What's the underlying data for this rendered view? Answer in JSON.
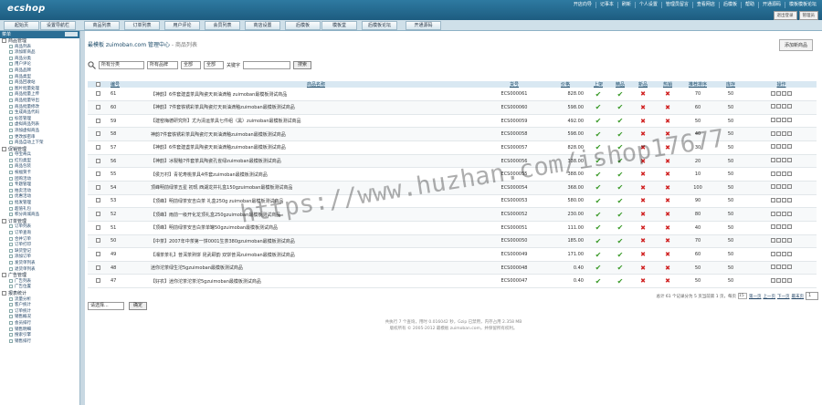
{
  "app": {
    "logo": "ecshop"
  },
  "top_links": [
    "开店向导",
    "记事本",
    "刷新",
    "个人设置",
    "管理员留言",
    "查看网店",
    "后模板",
    "帮助",
    "开通源码",
    "模板模板论坛"
  ],
  "top_buttons": [
    "退出登录",
    "管理员"
  ],
  "nav_tabs": [
    "起始页",
    "设置导航栏",
    "商品列表",
    "订单列表",
    "用户评论",
    "会员列表",
    "商店设置",
    "后模板",
    "模板堂",
    "后模板论坛",
    "开通源码"
  ],
  "sidebar": {
    "header": "菜单",
    "groups": [
      {
        "label": "商品管理",
        "items": [
          "商品列表",
          "添加新商品",
          "商品分类",
          "用户评论",
          "商品品牌",
          "商品类型",
          "商品回收站",
          "图片批量处理",
          "商品批量上传",
          "商品批量导出",
          "商品批量修改",
          "生成商品代码",
          "标签管理",
          "虚拟商品列表",
          "添加虚拟商品",
          "更改加密串",
          "商品自动上下架"
        ]
      },
      {
        "label": "促销管理",
        "items": [
          "夺宝奇兵",
          "红包类型",
          "商品包装",
          "祝福贺卡",
          "团购活动",
          "专题管理",
          "拍卖活动",
          "优惠活动",
          "批发管理",
          "超值礼包",
          "积分商城商品"
        ]
      },
      {
        "label": "订单管理",
        "items": [
          "订单列表",
          "订单查询",
          "合并订单",
          "订单打印",
          "缺货登记",
          "添加订单",
          "发货单列表",
          "退货单列表"
        ]
      },
      {
        "label": "广告管理",
        "items": [
          "广告列表",
          "广告位置"
        ]
      },
      {
        "label": "报表统计",
        "items": [
          "流量分析",
          "客户统计",
          "订单统计",
          "销售概况",
          "会员排行",
          "销售明细",
          "搜索引擎",
          "销售排行"
        ]
      }
    ]
  },
  "page": {
    "title": "最模板 zuimoban.com 管理中心",
    "subtitle": " - 商品列表",
    "add_button": "添加新商品"
  },
  "filter": {
    "category": "所有分类",
    "brand": "所有品牌",
    "all1": "全部",
    "all2": "全部",
    "keyword_label": "关键字",
    "search_button": "搜索"
  },
  "table": {
    "headers": [
      "编号",
      "商品名称",
      "货号",
      "价格",
      "上架",
      "精品",
      "新品",
      "热销",
      "推荐排序",
      "库存",
      "操作"
    ],
    "rows": [
      {
        "id": "61",
        "name": "【神韵】6件套建盏茶具陶瓷天目油滴釉 zuimoban最模板测试商品",
        "sn": "ECS000061",
        "price": "828.00",
        "on_sale": true,
        "best": true,
        "new": false,
        "hot": false,
        "sort": "70",
        "stock": "50"
      },
      {
        "id": "60",
        "name": "【神韵】7件套铁锈彩茶具陶瓷灯天目油滴釉zuimoban最模板测试商品",
        "sn": "ECS000060",
        "price": "598.00",
        "on_sale": true,
        "best": true,
        "new": false,
        "hot": false,
        "sort": "60",
        "stock": "50"
      },
      {
        "id": "59",
        "name": "【建窑梅德研究所】尤为清运茶具七件组（黑）zuimoban最模板测试商品",
        "sn": "ECS000059",
        "price": "492.00",
        "on_sale": true,
        "best": true,
        "new": false,
        "hot": false,
        "sort": "50",
        "stock": "50"
      },
      {
        "id": "58",
        "name": "神韵7件套铁锈彩茶具陶瓷灯天目油滴釉zuimoban最模板测试商品",
        "sn": "ECS000058",
        "price": "598.00",
        "on_sale": true,
        "best": true,
        "new": false,
        "hot": false,
        "sort": "40",
        "stock": "50"
      },
      {
        "id": "57",
        "name": "【神韵】6件套建盏茶具陶瓷天目油滴釉zuimoban最模板测试商品",
        "sn": "ECS000057",
        "price": "828.00",
        "on_sale": true,
        "best": true,
        "new": false,
        "hot": false,
        "sort": "30",
        "stock": "50"
      },
      {
        "id": "56",
        "name": "【神韵】冰裂釉7件套茶具陶瓷孔雀绿zuimoban最模板测试商品",
        "sn": "ECS000056",
        "price": "338.00",
        "on_sale": true,
        "best": true,
        "new": false,
        "hot": false,
        "sort": "20",
        "stock": "50"
      },
      {
        "id": "55",
        "name": "【侯万村】青花寿桃茶具4件套zuimoban最模板测试商品",
        "sn": "ECS000055",
        "price": "388.00",
        "on_sale": true,
        "best": true,
        "new": false,
        "hot": false,
        "sort": "10",
        "stock": "50"
      },
      {
        "id": "54",
        "name": "顶峰明前绿茶五星 初现 西湖龙井礼盒150gzuimoban最模板测试商品",
        "sn": "ECS000054",
        "price": "368.00",
        "on_sale": true,
        "best": true,
        "new": false,
        "hot": false,
        "sort": "100",
        "stock": "50"
      },
      {
        "id": "53",
        "name": "【顶峰】明前绿茶安吉白茶 礼盒250g zuimoban最模板测试商品",
        "sn": "ECS000053",
        "price": "580.00",
        "on_sale": true,
        "best": true,
        "new": false,
        "hot": false,
        "sort": "90",
        "stock": "50"
      },
      {
        "id": "52",
        "name": "【顶峰】雨前一级开化龙顶礼盒250gzuimoban最模板测试商品",
        "sn": "ECS000052",
        "price": "230.00",
        "on_sale": true,
        "best": true,
        "new": false,
        "hot": false,
        "sort": "80",
        "stock": "50"
      },
      {
        "id": "51",
        "name": "【顶峰】明前绿茶安吉白茶单罐50gzuimoban最模板测试商品",
        "sn": "ECS000051",
        "price": "111.00",
        "on_sale": true,
        "best": true,
        "new": false,
        "hot": false,
        "sort": "40",
        "stock": "50"
      },
      {
        "id": "50",
        "name": "【中茶】2007年中茶第一饼0001生茶380gzuimoban最模板测试商品",
        "sn": "ECS000050",
        "price": "185.00",
        "on_sale": true,
        "best": true,
        "new": false,
        "hot": false,
        "sort": "70",
        "stock": "50"
      },
      {
        "id": "49",
        "name": "【湘茶茶礼】普洱茶熟饼 昆武颐韵 双饼普洱zuimoban最模板测试商品",
        "sn": "ECS000049",
        "price": "171.00",
        "on_sale": true,
        "best": true,
        "new": false,
        "hot": false,
        "sort": "60",
        "stock": "50"
      },
      {
        "id": "48",
        "name": "迷你沱茶绿生沱5gzuimoban最模板测试商品",
        "sn": "ECS000048",
        "price": "0.40",
        "on_sale": true,
        "best": true,
        "new": false,
        "hot": false,
        "sort": "50",
        "stock": "50"
      },
      {
        "id": "47",
        "name": "【好农】迷你沱茶沱茶沱5gzuimoban最模板测试商品",
        "sn": "ECS000047",
        "price": "0.40",
        "on_sale": true,
        "best": true,
        "new": false,
        "hot": false,
        "sort": "50",
        "stock": "50"
      }
    ]
  },
  "pager": {
    "summary": "总计 61 个记录分为 5 页当前第 1 页，每页",
    "per_page": "15",
    "links": [
      "第一页",
      "上一页",
      "下一页",
      "最末页"
    ],
    "page_select": "1"
  },
  "bottom": {
    "select": "请选择...",
    "confirm": "确定"
  },
  "footer": {
    "line1": "共执行 7 个查询，用时 0.016042 秒，Gzip 已禁用，内存占用 2.358 MB",
    "line2": "版权所有 © 2005-2012 最模板 zuimoban.com，并保留所有权利。"
  },
  "watermark": "https://www.huzhan.com/ishop17677"
}
